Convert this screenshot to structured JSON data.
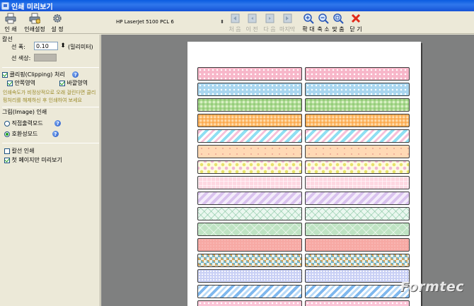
{
  "window": {
    "title": "인쇄 미리보기"
  },
  "toolbar": {
    "print": "인 쇄",
    "print_settings": "인쇄설정",
    "settings": "설 정",
    "printer": "HP LaserJet 5100 PCL 6",
    "first": "처 음",
    "prev": "이 전",
    "next": "다 음",
    "last": "마지막",
    "zoom_in": "확 대",
    "zoom_out": "축 소",
    "fit": "맞 춤",
    "close": "닫 기"
  },
  "panel": {
    "cut_line_header": "칼선",
    "line_width_label": "선 폭:",
    "line_width_value": "0.10",
    "line_width_unit": "(밀리미터)",
    "line_color_label": "선 색상:",
    "clipping_label": "클리핑(Clipping) 처리",
    "clip_inner": "안쪽영역",
    "clip_outer": "바깥영역",
    "clip_warning": "인쇄속도가 비정상적으로 오래 걸린다면 클리핑처리를 해제하신 후 인쇄하여 보세요",
    "image_print_header": "그림(Image) 인쇄",
    "direct_mode": "직접출력모드",
    "compat_mode": "호환성모드",
    "cut_line_print": "칼선 인쇄",
    "first_page_only": "첫 페이지만 미리보기"
  },
  "watermark": "Formtec",
  "label_patterns": [
    "pink-dots",
    "blue-dots",
    "green-gingham",
    "orange-check",
    "cyan-stripes",
    "peach-dots",
    "yellow-circles",
    "pink-plaid",
    "lavender-stripes",
    "mint-lattice",
    "green-diamonds",
    "coral-solid",
    "gold-diamonds",
    "periwinkle-dots",
    "blue-stripes",
    "pink-dots-2"
  ]
}
